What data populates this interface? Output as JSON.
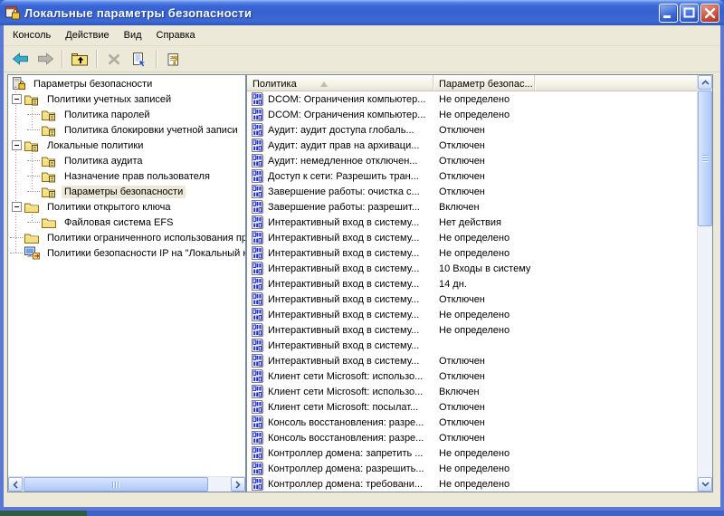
{
  "window": {
    "title": "Локальные параметры безопасности"
  },
  "menu": {
    "items": [
      "Консоль",
      "Действие",
      "Вид",
      "Справка"
    ]
  },
  "toolbar": {
    "buttons": [
      {
        "icon": "back-icon",
        "enabled": true
      },
      {
        "icon": "forward-icon",
        "enabled": false
      },
      {
        "sep": true
      },
      {
        "icon": "up-level-icon",
        "enabled": true
      },
      {
        "sep": true
      },
      {
        "icon": "delete-icon",
        "enabled": false
      },
      {
        "icon": "properties-icon",
        "enabled": true
      },
      {
        "sep": true
      },
      {
        "icon": "help-icon",
        "enabled": true
      }
    ]
  },
  "tree": {
    "items": [
      {
        "label": "Параметры безопасности",
        "level": 0,
        "icon": "console-root-icon",
        "expander": "none",
        "selected": false
      },
      {
        "label": "Политики учетных записей",
        "level": 1,
        "icon": "folder-policy-icon",
        "expander": "minus",
        "selected": false
      },
      {
        "label": "Политика паролей",
        "level": 2,
        "icon": "folder-policy-icon",
        "expander": "none",
        "selected": false
      },
      {
        "label": "Политика блокировки учетной записи",
        "level": 2,
        "icon": "folder-policy-icon",
        "expander": "none",
        "selected": false
      },
      {
        "label": "Локальные политики",
        "level": 1,
        "icon": "folder-policy-icon",
        "expander": "minus",
        "selected": false
      },
      {
        "label": "Политика аудита",
        "level": 2,
        "icon": "folder-policy-icon",
        "expander": "none",
        "selected": false
      },
      {
        "label": "Назначение прав пользователя",
        "level": 2,
        "icon": "folder-policy-icon",
        "expander": "none",
        "selected": false
      },
      {
        "label": "Параметры безопасности",
        "level": 2,
        "icon": "folder-policy-icon",
        "expander": "none",
        "selected": true
      },
      {
        "label": "Политики открытого ключа",
        "level": 1,
        "icon": "folder-icon",
        "expander": "minus",
        "selected": false
      },
      {
        "label": "Файловая система EFS",
        "level": 2,
        "icon": "folder-icon",
        "expander": "none",
        "selected": false
      },
      {
        "label": "Политики ограниченного использования пр",
        "level": 1,
        "icon": "folder-icon",
        "expander": "none",
        "selected": false
      },
      {
        "label": "Политики безопасности IP на \"Локальный к",
        "level": 1,
        "icon": "ipsec-icon",
        "expander": "none",
        "selected": false
      }
    ]
  },
  "list": {
    "columns": [
      {
        "label": "Политика",
        "sort": "asc"
      },
      {
        "label": "Параметр безопас..."
      }
    ],
    "rows": [
      {
        "name": "DCOM: Ограничения компьютер...",
        "value": "Не определено"
      },
      {
        "name": "DCOM: Ограничения компьютер...",
        "value": "Не определено"
      },
      {
        "name": "Аудит: аудит доступа глобаль...",
        "value": "Отключен"
      },
      {
        "name": "Аудит: аудит прав на архиваци...",
        "value": "Отключен"
      },
      {
        "name": "Аудит: немедленное отключен...",
        "value": "Отключен"
      },
      {
        "name": "Доступ к сети: Разрешить тран...",
        "value": "Отключен"
      },
      {
        "name": "Завершение работы: очистка с...",
        "value": "Отключен"
      },
      {
        "name": "Завершение работы: разрешит...",
        "value": "Включен"
      },
      {
        "name": "Интерактивный вход в систему...",
        "value": "Нет действия"
      },
      {
        "name": "Интерактивный вход в систему...",
        "value": "Не определено"
      },
      {
        "name": "Интерактивный вход в систему...",
        "value": "Не определено"
      },
      {
        "name": "Интерактивный вход в систему...",
        "value": "10 Входы в систему"
      },
      {
        "name": "Интерактивный вход в систему...",
        "value": "14 дн."
      },
      {
        "name": "Интерактивный вход в систему...",
        "value": "Отключен"
      },
      {
        "name": "Интерактивный вход в систему...",
        "value": "Не определено"
      },
      {
        "name": "Интерактивный вход в систему...",
        "value": "Не определено"
      },
      {
        "name": "Интерактивный вход в систему...",
        "value": ""
      },
      {
        "name": "Интерактивный вход в систему...",
        "value": "Отключен"
      },
      {
        "name": "Клиент сети Microsoft: использо...",
        "value": "Отключен"
      },
      {
        "name": "Клиент сети Microsoft: использо...",
        "value": "Включен"
      },
      {
        "name": "Клиент сети Microsoft: посылат...",
        "value": "Отключен"
      },
      {
        "name": "Консоль восстановления: разре...",
        "value": "Отключен"
      },
      {
        "name": "Консоль восстановления: разре...",
        "value": "Отключен"
      },
      {
        "name": "Контроллер домена: запретить ...",
        "value": "Не определено"
      },
      {
        "name": "Контроллер домена: разрешить...",
        "value": "Не определено"
      },
      {
        "name": "Контроллер домена: требовани...",
        "value": "Не определено"
      }
    ]
  },
  "colors": {
    "titlebar_blue": "#3A67D8",
    "window_border": "#5A78D4",
    "chrome_beige": "#ECE9D8",
    "selection_inactive": "#ECE9D8",
    "list_icon_blue": "#2030C8",
    "close_button_red": "#CE5240"
  }
}
